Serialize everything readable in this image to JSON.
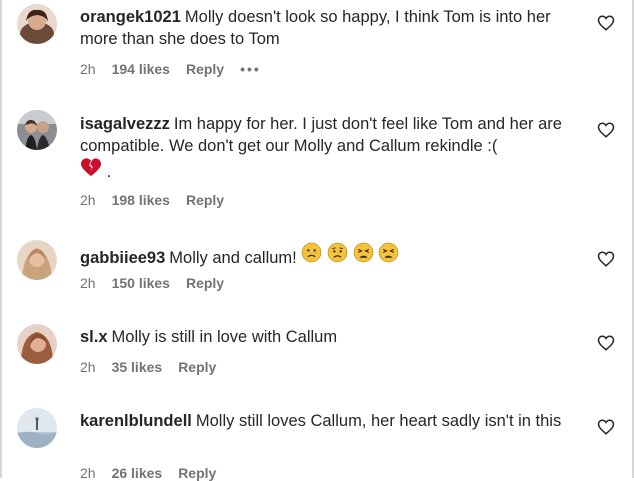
{
  "comments": [
    {
      "username": "orangek1021",
      "text": "Molly doesn't look so happy, I think Tom is into her more than she does to Tom",
      "time": "2h",
      "likes": "194 likes",
      "reply": "Reply",
      "more": "•••",
      "avatar_color": "#c89a7c"
    },
    {
      "username": "isagalvezzz",
      "text": "Im happy for her. I just don't feel like Tom and her are compatible. We don't get our Molly and Callum rekindle :(",
      "text_suffix": ".",
      "emoji": "broken-heart-icon",
      "time": "2h",
      "likes": "198 likes",
      "reply": "Reply",
      "avatar_color": "#5a6470"
    },
    {
      "username": "gabbiiee93",
      "text": "Molly and callum!",
      "emoji": [
        "sad-relieved-face-icon",
        "worried-face-icon",
        "tired-face-icon",
        "tired-face-icon"
      ],
      "time": "2h",
      "likes": "150 likes",
      "reply": "Reply",
      "avatar_color": "#d8b79a"
    },
    {
      "username": "sl.x",
      "text": "Molly is still in love with Callum",
      "time": "2h",
      "likes": "35 likes",
      "reply": "Reply",
      "avatar_color": "#b27d60"
    },
    {
      "username": "karenlblundell",
      "text": "Molly still loves Callum, her heart sadly isn't in this",
      "time": "2h",
      "likes": "26 likes",
      "reply": "Reply",
      "avatar_color": "#aebfcf"
    }
  ],
  "colors": {
    "text": "#262626",
    "meta": "#737373",
    "emoji_yellow": "#f5c33b",
    "heart_red": "#c8102e"
  }
}
